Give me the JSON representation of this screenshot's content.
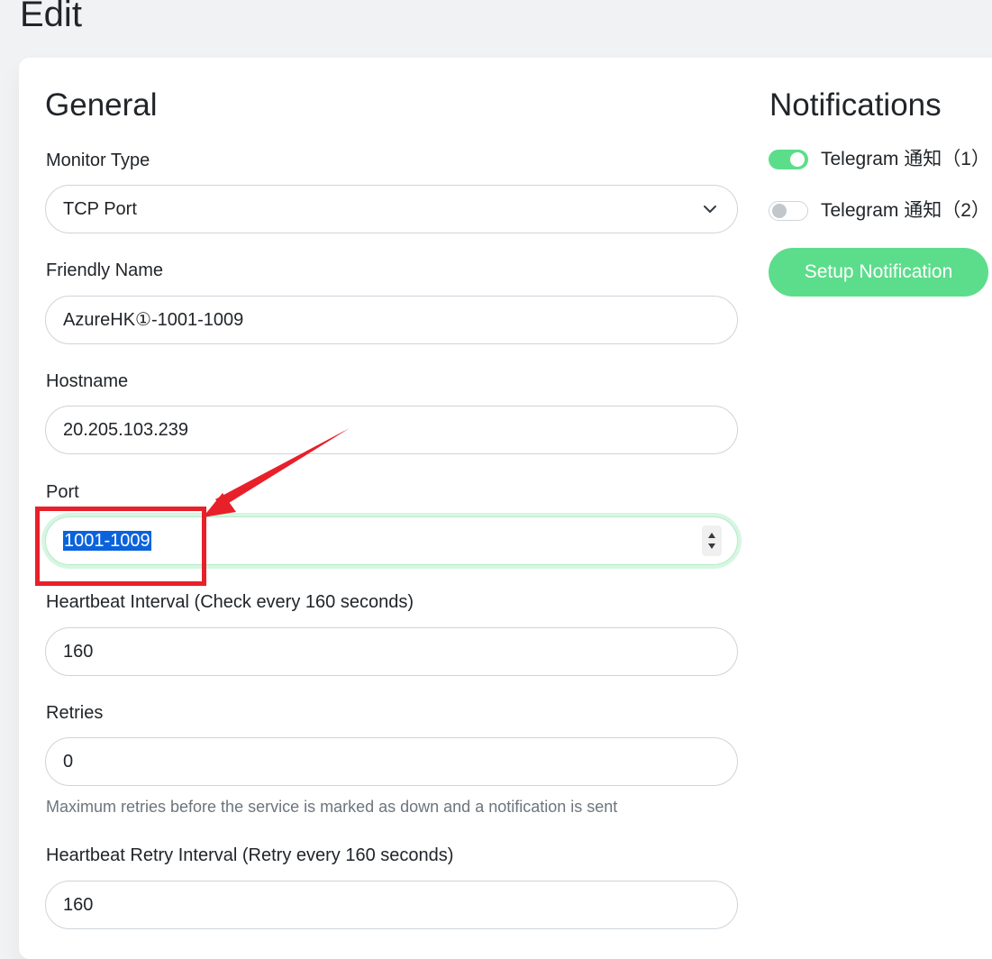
{
  "page": {
    "title": "Edit"
  },
  "general": {
    "title": "General",
    "monitor_type": {
      "label": "Monitor Type",
      "value": "TCP Port"
    },
    "friendly_name": {
      "label": "Friendly Name",
      "value": "AzureHK①-1001-1009"
    },
    "hostname": {
      "label": "Hostname",
      "value": "20.205.103.239"
    },
    "port": {
      "label": "Port",
      "value": "1001-1009"
    },
    "heartbeat_interval": {
      "label": "Heartbeat Interval (Check every 160 seconds)",
      "value": "160"
    },
    "retries": {
      "label": "Retries",
      "value": "0",
      "help": "Maximum retries before the service is marked as down and a notification is sent"
    },
    "retry_interval": {
      "label": "Heartbeat Retry Interval (Retry every 160 seconds)",
      "value": "160"
    }
  },
  "notifications": {
    "title": "Notifications",
    "items": [
      {
        "label": "Telegram 通知（1）",
        "enabled": true
      },
      {
        "label": "Telegram 通知（2）",
        "enabled": false
      }
    ],
    "setup_button": "Setup Notification"
  },
  "colors": {
    "accent": "#5cdd8b",
    "annotation": "#e8202a",
    "selection": "#0a63dc"
  },
  "icons": {
    "monitor_type_dropdown": "chevron-down-icon",
    "port_spinner": "spinner-arrows-icon"
  }
}
